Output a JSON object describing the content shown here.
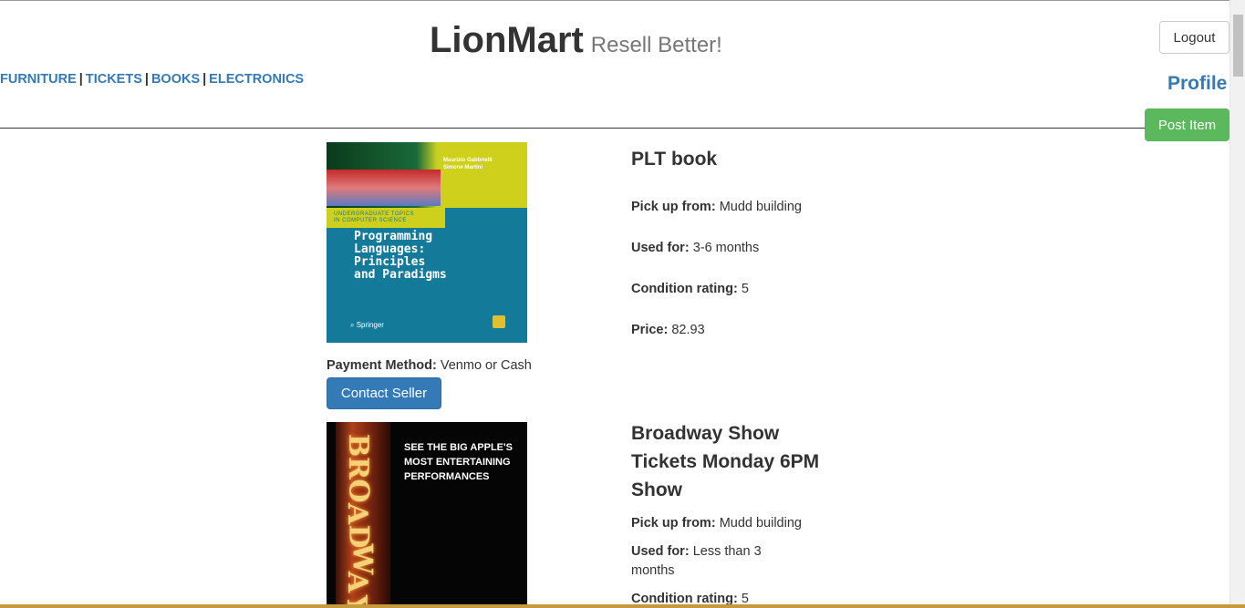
{
  "header": {
    "brand_name": "LionMart",
    "brand_tagline": "Resell Better!",
    "logout_label": "Logout",
    "profile_label": "Profile",
    "post_item_label": "Post Item"
  },
  "nav": {
    "categories": [
      "FURNITURE",
      "TICKETS",
      "BOOKS",
      "ELECTRONICS"
    ],
    "separator": "|"
  },
  "labels": {
    "pickup": "Pick up from:",
    "used_for": "Used for:",
    "condition": "Condition rating:",
    "price": "Price:",
    "payment": "Payment Method:",
    "contact": "Contact Seller"
  },
  "listings": [
    {
      "title": "PLT book",
      "pickup": "Mudd building",
      "used_for": "3-6 months",
      "condition": "5",
      "price": "82.93",
      "payment": "Venmo or Cash",
      "cover": {
        "authors": [
          "Maurizio Gabbrielli",
          "Simone Martini"
        ],
        "series": [
          "UNDERGRADUATE TOPICS",
          "IN COMPUTER SCIENCE"
        ],
        "book_title": [
          "Programming",
          "Languages:",
          "Principles",
          "and Paradigms"
        ],
        "publisher": "Springer"
      }
    },
    {
      "title": "Broadway Show Tickets Monday 6PM Show",
      "pickup": "Mudd building",
      "used_for": "Less than 3 months",
      "condition": "5",
      "cover": {
        "sign_letters": [
          "B",
          "R",
          "O",
          "A",
          "D",
          "W",
          "A",
          "Y"
        ],
        "tagline": [
          "SEE THE BIG APPLE'S",
          "MOST ENTERTAINING",
          "PERFORMANCES"
        ]
      }
    }
  ],
  "colors": {
    "link": "#337ab7",
    "post_button": "#5cb85c",
    "contact_button": "#337ab7"
  }
}
